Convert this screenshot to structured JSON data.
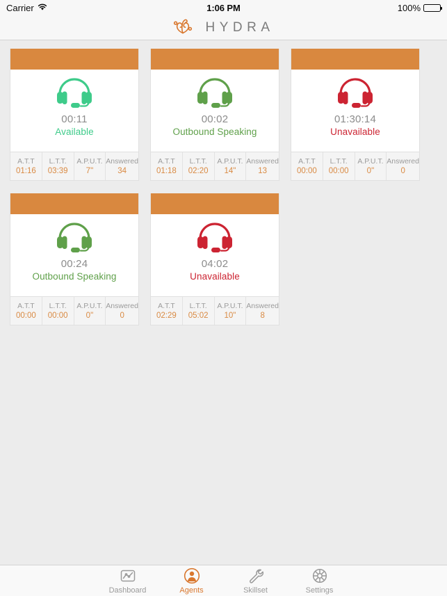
{
  "status_bar": {
    "carrier": "Carrier",
    "wifi_icon": "wifi-icon",
    "time": "1:06 PM",
    "battery_percent": "100%",
    "battery_icon": "battery-full-icon"
  },
  "navbar": {
    "logo_icon": "hydra-lotus-logo-icon",
    "brand": "HYDRA"
  },
  "colors": {
    "header_orange": "#d9883f",
    "accent_orange": "#d9772e",
    "stat_value_orange": "#d98a43",
    "available_green": "#3ecb8a",
    "speaking_green": "#5fa04a",
    "unavailable_red": "#cc2432",
    "timer_grey": "#8c8c8c",
    "background": "#ececec"
  },
  "agents": [
    {
      "headset_icon": "headset-icon",
      "state_color": "#3ecb8a",
      "timer": "00:11",
      "status": "Available",
      "stats": [
        {
          "label": "A.T.T",
          "value": "01:16"
        },
        {
          "label": "L.T.T.",
          "value": "03:39"
        },
        {
          "label": "A.P.U.T.",
          "value": "7\""
        },
        {
          "label": "Answered",
          "value": "34"
        }
      ]
    },
    {
      "headset_icon": "headset-icon",
      "state_color": "#5fa04a",
      "timer": "00:02",
      "status": "Outbound Speaking",
      "stats": [
        {
          "label": "A.T.T",
          "value": "01:18"
        },
        {
          "label": "L.T.T.",
          "value": "02:20"
        },
        {
          "label": "A.P.U.T.",
          "value": "14\""
        },
        {
          "label": "Answered",
          "value": "13"
        }
      ]
    },
    {
      "headset_icon": "headset-icon",
      "state_color": "#cc2432",
      "timer": "01:30:14",
      "status": "Unavailable",
      "stats": [
        {
          "label": "A.T.T",
          "value": "00:00"
        },
        {
          "label": "L.T.T.",
          "value": "00:00"
        },
        {
          "label": "A.P.U.T.",
          "value": "0\""
        },
        {
          "label": "Answered",
          "value": "0"
        }
      ]
    },
    {
      "headset_icon": "headset-icon",
      "state_color": "#5fa04a",
      "timer": "00:24",
      "status": "Outbound Speaking",
      "stats": [
        {
          "label": "A.T.T",
          "value": "00:00"
        },
        {
          "label": "L.T.T.",
          "value": "00:00"
        },
        {
          "label": "A.P.U.T.",
          "value": "0\""
        },
        {
          "label": "Answered",
          "value": "0"
        }
      ]
    },
    {
      "headset_icon": "headset-icon",
      "state_color": "#cc2432",
      "timer": "04:02",
      "status": "Unavailable",
      "stats": [
        {
          "label": "A.T.T",
          "value": "02:29"
        },
        {
          "label": "L.T.T.",
          "value": "05:02"
        },
        {
          "label": "A.P.U.T.",
          "value": "10\""
        },
        {
          "label": "Answered",
          "value": "8"
        }
      ]
    }
  ],
  "tabbar": {
    "tabs": [
      {
        "label": "Dashboard",
        "icon": "chart-icon",
        "active": false
      },
      {
        "label": "Agents",
        "icon": "person-icon",
        "active": true
      },
      {
        "label": "Skillset",
        "icon": "wrench-icon",
        "active": false
      },
      {
        "label": "Settings",
        "icon": "gear-icon",
        "active": false
      }
    ]
  }
}
